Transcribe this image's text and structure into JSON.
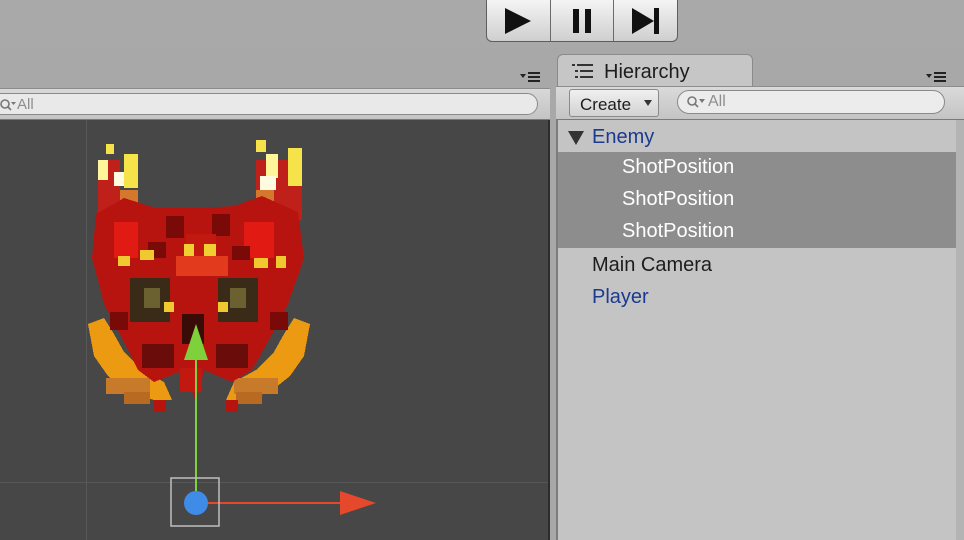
{
  "toolbar": {
    "play_icon": "play-icon",
    "pause_icon": "pause-icon",
    "step_icon": "step-icon"
  },
  "scene": {
    "search_placeholder": "All",
    "sprite_icon": "enemy-sprite",
    "gizmo_colors": {
      "y_axis": "#7fd13b",
      "x_axis": "#e5482a",
      "center": "#3f8be8"
    }
  },
  "hierarchy": {
    "tab_label": "Hierarchy",
    "create_label": "Create",
    "search_placeholder": "All",
    "items": [
      {
        "label": "Enemy",
        "expanded": true,
        "prefab": true,
        "selected": false
      },
      {
        "label": "ShotPosition",
        "selected": true
      },
      {
        "label": "ShotPosition",
        "selected": true
      },
      {
        "label": "ShotPosition",
        "selected": true
      },
      {
        "label": "Main Camera",
        "prefab": false,
        "selected": false
      },
      {
        "label": "Player",
        "prefab": true,
        "selected": false
      }
    ],
    "colors": {
      "prefab": "#1b3a8f",
      "normal": "#1d1d1d",
      "selected_bg": "#8d8d8d"
    }
  }
}
